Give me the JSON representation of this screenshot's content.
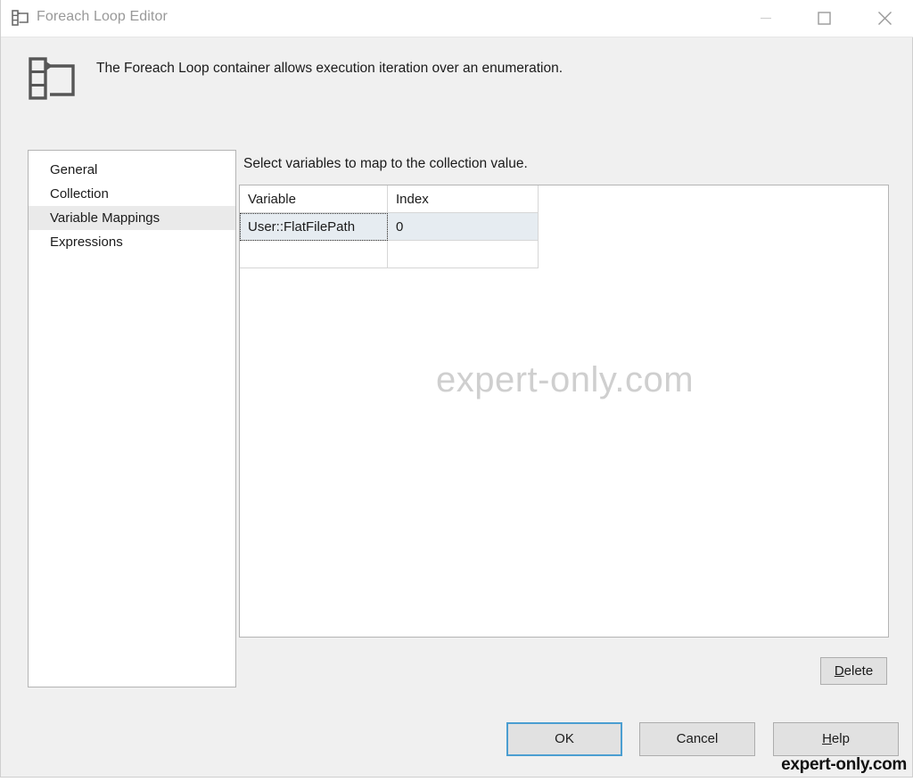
{
  "window": {
    "title": "Foreach Loop Editor",
    "icon": "foreach-loop-icon",
    "controls": {
      "minimize": "minimize-icon",
      "maximize": "maximize-icon",
      "close": "close-icon"
    }
  },
  "header": {
    "icon": "foreach-loop-icon",
    "description": "The Foreach Loop container allows execution iteration over an enumeration."
  },
  "sidebar": {
    "items": [
      {
        "label": "General",
        "selected": false
      },
      {
        "label": "Collection",
        "selected": false
      },
      {
        "label": "Variable Mappings",
        "selected": true
      },
      {
        "label": "Expressions",
        "selected": false
      }
    ]
  },
  "main": {
    "instruction": "Select variables to map to the collection value.",
    "grid": {
      "columns": [
        "Variable",
        "Index"
      ],
      "rows": [
        {
          "variable": "User::FlatFilePath",
          "index": "0",
          "selected": true,
          "focused_cell": "variable"
        },
        {
          "variable": "",
          "index": "",
          "selected": false,
          "focused_cell": ""
        }
      ]
    },
    "watermark": "expert-only.com"
  },
  "buttons": {
    "delete": {
      "label": "Delete",
      "accelerator": "D"
    },
    "ok": {
      "label": "OK",
      "focused": true
    },
    "cancel": {
      "label": "Cancel"
    },
    "help": {
      "label": "Help",
      "accelerator": "H"
    }
  },
  "overlay": {
    "corner_watermark": "expert-only.com"
  },
  "colors": {
    "dialog_background": "#f0f0f0",
    "titlebar_background": "#ffffff",
    "title_text": "#999999",
    "selection_highlight": "#e6ecf1",
    "sidebar_selection": "#eaeaea",
    "focus_border": "#4b9ed1",
    "watermark": "#cfcfcf"
  }
}
